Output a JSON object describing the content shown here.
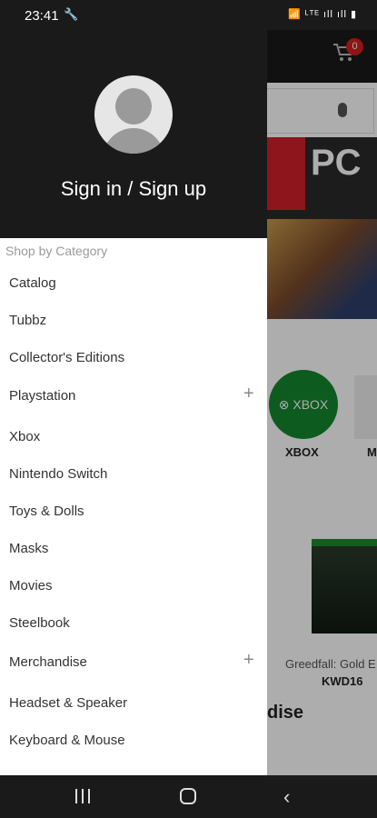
{
  "status_bar": {
    "time": "23:41",
    "wrench_icon": "🔧",
    "right_icons": "📶 ᴸᵀᴱ ıll ıll ▮"
  },
  "background": {
    "cart_badge": "0",
    "banner_text": "PC",
    "brand_label": "XBOX",
    "brand_circle_text": "⊗ XBOX",
    "partial_brand_label": "M",
    "product_name": "Greedfall: Gold E",
    "product_price": "KWD16",
    "section_title": "dise"
  },
  "drawer": {
    "sign_in": "Sign in / Sign up",
    "section_label": "Shop by Category",
    "items": [
      {
        "label": "Catalog",
        "expandable": false
      },
      {
        "label": "Tubbz",
        "expandable": false
      },
      {
        "label": "Collector's Editions",
        "expandable": false
      },
      {
        "label": "Playstation",
        "expandable": true,
        "expand_icon": "+"
      },
      {
        "label": "Xbox",
        "expandable": false
      },
      {
        "label": "Nintendo Switch",
        "expandable": false
      },
      {
        "label": "Toys & Dolls",
        "expandable": false
      },
      {
        "label": "Masks",
        "expandable": false
      },
      {
        "label": "Movies",
        "expandable": false
      },
      {
        "label": "Steelbook",
        "expandable": false
      },
      {
        "label": "Merchandise",
        "expandable": true,
        "expand_icon": "+"
      },
      {
        "label": "Headset & Speaker",
        "expandable": false
      },
      {
        "label": "Keyboard & Mouse",
        "expandable": false
      }
    ]
  },
  "nav_bar": {
    "back_glyph": "‹"
  },
  "colors": {
    "header_bg": "#1a1a1a",
    "badge_red": "#d32020",
    "xbox_green": "#14862e"
  }
}
